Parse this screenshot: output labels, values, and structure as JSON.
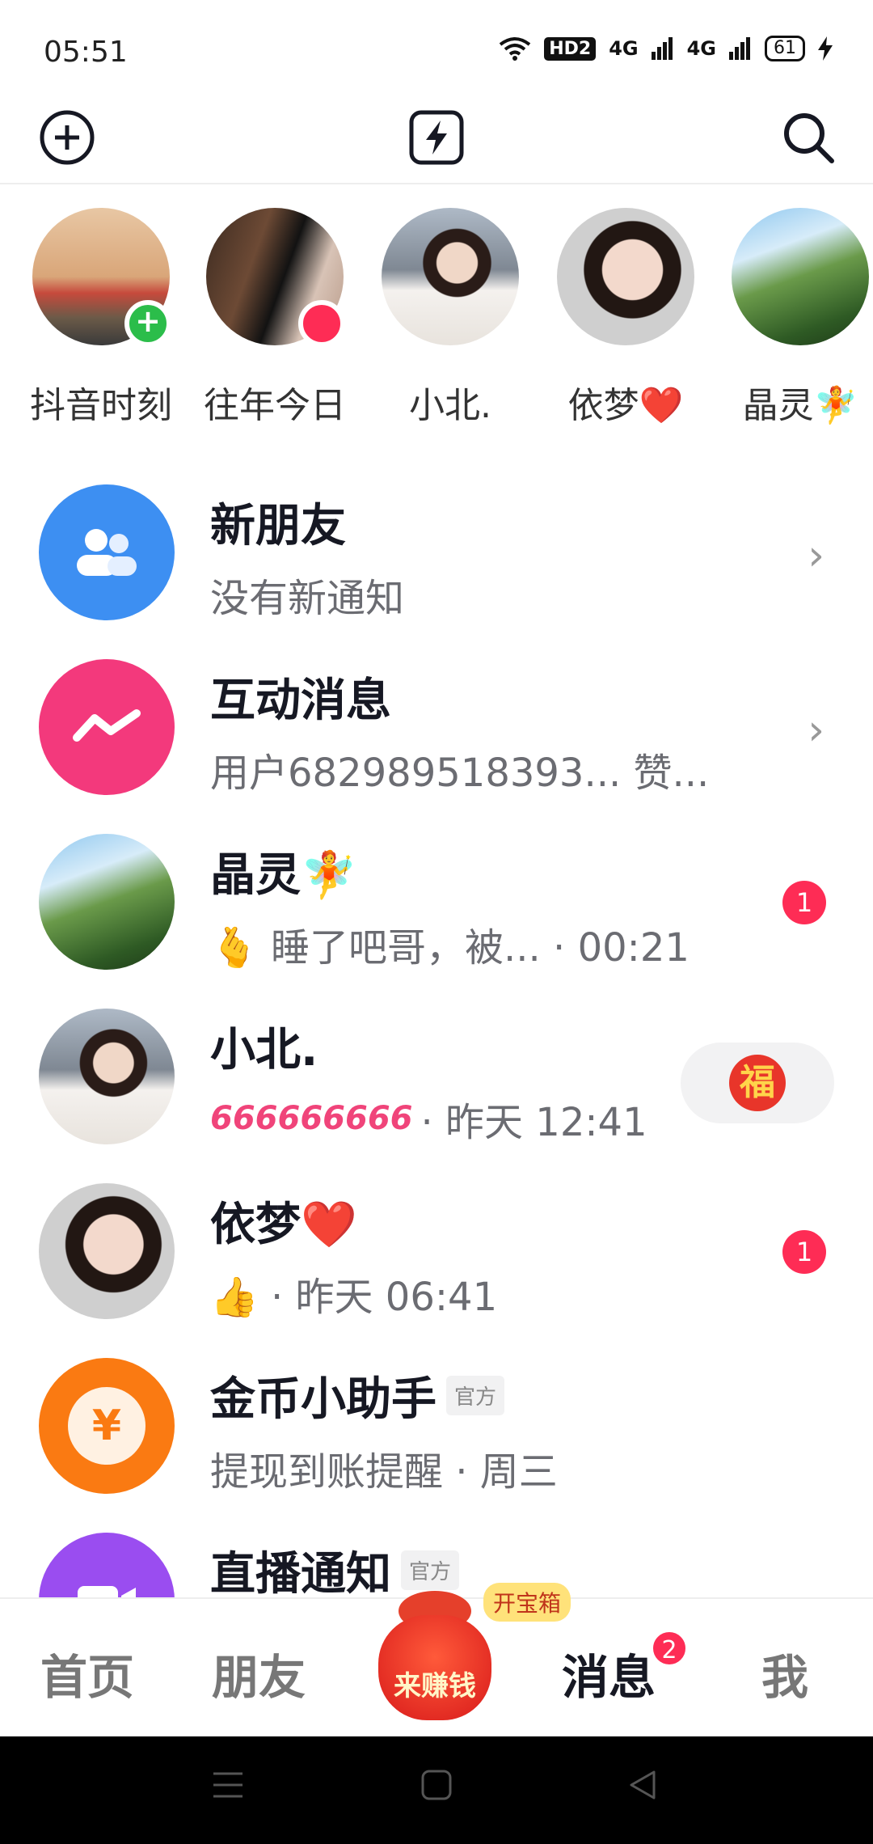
{
  "status_bar": {
    "time": "05:51",
    "hd": "HD2",
    "signal1": "4G",
    "signal2": "4G",
    "battery": "61"
  },
  "stories": [
    {
      "label": "抖音时刻",
      "badge": "+"
    },
    {
      "label": "往年今日"
    },
    {
      "label": "小北."
    },
    {
      "label": "依梦❤️"
    },
    {
      "label": "晶灵🧚"
    }
  ],
  "messages": [
    {
      "title": "新朋友",
      "subtitle": "没有新通知"
    },
    {
      "title": "互动消息",
      "subtitle": "用户682989518393... 赞..."
    },
    {
      "title": "晶灵🧚",
      "subtitle": "🫰 睡了吧哥，被...  · 00:21",
      "unread": "1"
    },
    {
      "title": "小北.",
      "subtitle_prefix": "666666666",
      "subtitle": " · 昨天 12:41",
      "fu": "福"
    },
    {
      "title": "依梦❤️",
      "subtitle": "👍 · 昨天 06:41",
      "unread": "1"
    },
    {
      "title": "金币小助手",
      "tag": "官方",
      "subtitle": "提现到账提醒  · 周三",
      "icon_text": "¥"
    },
    {
      "title": "直播通知",
      "tag": "官方"
    }
  ],
  "bottom_nav": {
    "home": "首页",
    "friends": "朋友",
    "earn": "来赚钱",
    "chest": "开宝箱",
    "messages": "消息",
    "messages_badge": "2",
    "me": "我"
  },
  "colors": {
    "accent": "#fe2c55",
    "green": "#2bbd4a",
    "blue": "#3d8ff2",
    "pink": "#f3397c",
    "orange": "#fa7a12",
    "purple": "#9a4df0"
  }
}
